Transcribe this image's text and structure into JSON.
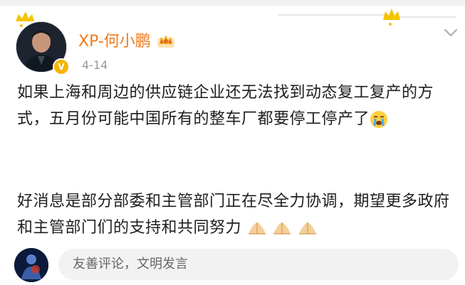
{
  "post": {
    "username": "XP-何小鹏",
    "date": "4-14",
    "paragraph1": "如果上海和周边的供应链企业还无法找到动态复工复产的方式，五月份可能中国所有的整车厂都要停工停产了",
    "paragraph2": "好消息是部分部委和主管部门正在尽全力协调，期望更多政府和主管部门们的支持和共同努力",
    "verified_mark": "V"
  },
  "comment": {
    "placeholder": "友善评论，文明发言"
  },
  "colors": {
    "username": "#ef7a18",
    "verified_badge": "#f5b400",
    "date": "#999999",
    "comment_bg": "#f2f2f2"
  },
  "icons": {
    "vip": "crown-badge-icon",
    "more": "chevron-down-icon",
    "crying": "crying-face-emoji",
    "pray": "praying-hands-emoji"
  }
}
